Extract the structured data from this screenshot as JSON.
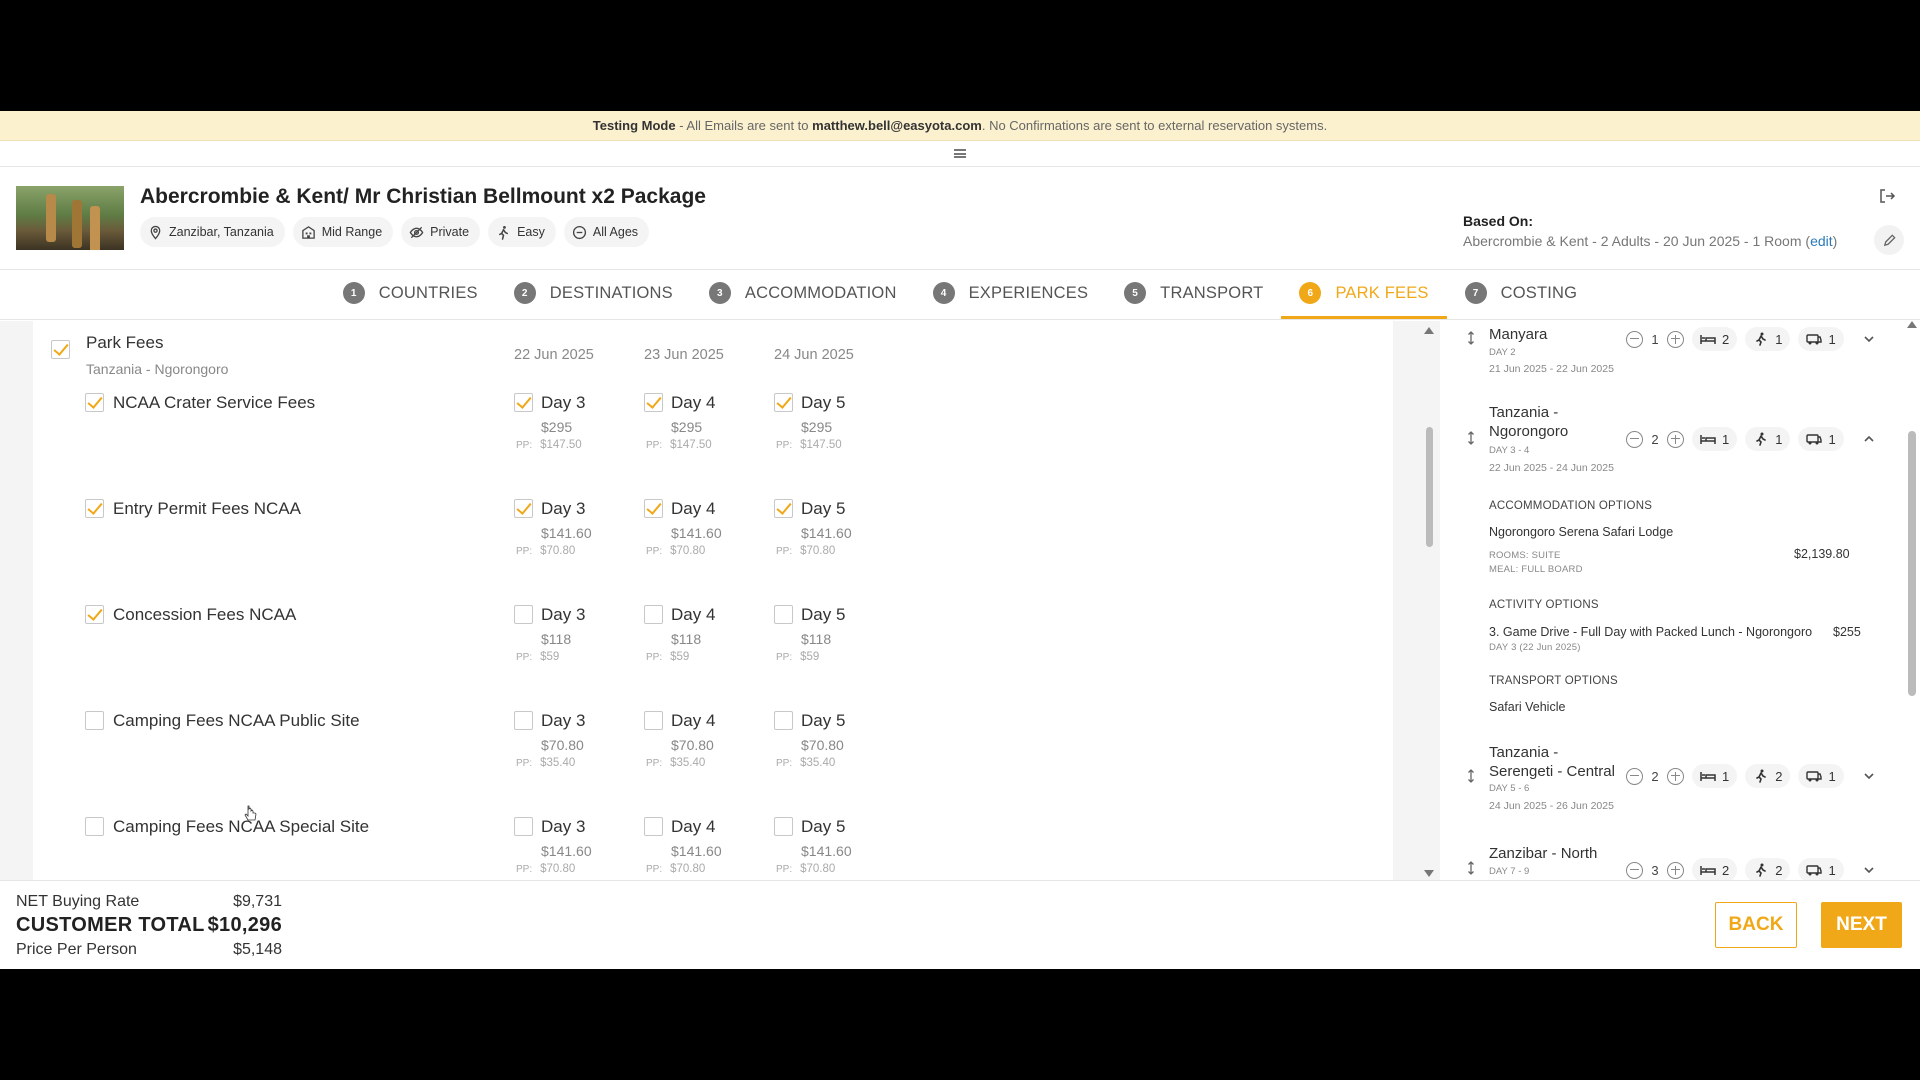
{
  "banner": {
    "mode": "Testing Mode",
    "part1": " - All Emails are sent to ",
    "email": "matthew.bell@easyota.com",
    "part2": ". No Confirmations are sent to external reservation systems."
  },
  "package": {
    "title": "Abercrombie & Kent/ Mr Christian Bellmount x2 Package",
    "chips": {
      "location": "Zanzibar, Tanzania",
      "range": "Mid Range",
      "privacy": "Private",
      "level": "Easy",
      "ages": "All Ages"
    },
    "based_label": "Based On:",
    "based_value": "Abercrombie & Kent - 2 Adults - 20 Jun 2025 - 1 Room (",
    "edit": "edit",
    "based_close": ")"
  },
  "steps": [
    {
      "num": "1",
      "label": "COUNTRIES"
    },
    {
      "num": "2",
      "label": "DESTINATIONS"
    },
    {
      "num": "3",
      "label": "ACCOMMODATION"
    },
    {
      "num": "4",
      "label": "EXPERIENCES"
    },
    {
      "num": "5",
      "label": "TRANSPORT"
    },
    {
      "num": "6",
      "label": "PARK FEES"
    },
    {
      "num": "7",
      "label": "COSTING"
    }
  ],
  "park_fees": {
    "title": "Park Fees",
    "subtitle": "Tanzania - Ngorongoro",
    "dates": [
      "22 Jun 2025",
      "23 Jun 2025",
      "24 Jun 2025"
    ],
    "pp_label": "PP:",
    "fees": [
      {
        "name": "NCAA Crater Service Fees",
        "days": [
          {
            "label": "Day 3",
            "price": "$295",
            "pp": "$147.50"
          },
          {
            "label": "Day 4",
            "price": "$295",
            "pp": "$147.50"
          },
          {
            "label": "Day 5",
            "price": "$295",
            "pp": "$147.50"
          }
        ]
      },
      {
        "name": "Entry Permit Fees NCAA",
        "days": [
          {
            "label": "Day 3",
            "price": "$141.60",
            "pp": "$70.80"
          },
          {
            "label": "Day 4",
            "price": "$141.60",
            "pp": "$70.80"
          },
          {
            "label": "Day 5",
            "price": "$141.60",
            "pp": "$70.80"
          }
        ]
      },
      {
        "name": "Concession Fees NCAA",
        "days": [
          {
            "label": "Day 3",
            "price": "$118",
            "pp": "$59"
          },
          {
            "label": "Day 4",
            "price": "$118",
            "pp": "$59"
          },
          {
            "label": "Day 5",
            "price": "$118",
            "pp": "$59"
          }
        ]
      },
      {
        "name": "Camping Fees NCAA Public Site",
        "days": [
          {
            "label": "Day 3",
            "price": "$70.80",
            "pp": "$35.40"
          },
          {
            "label": "Day 4",
            "price": "$70.80",
            "pp": "$35.40"
          },
          {
            "label": "Day 5",
            "price": "$70.80",
            "pp": "$35.40"
          }
        ]
      },
      {
        "name": "Camping Fees NCAA Special Site",
        "days": [
          {
            "label": "Day 3",
            "price": "$141.60",
            "pp": "$70.80"
          },
          {
            "label": "Day 4",
            "price": "$141.60",
            "pp": "$70.80"
          },
          {
            "label": "Day 5",
            "price": "$141.60",
            "pp": "$70.80"
          }
        ]
      }
    ]
  },
  "itinerary": [
    {
      "name1": "Manyara",
      "name2": "",
      "day": "DAY 2",
      "dates": "21 Jun 2025 - 22 Jun 2025",
      "nights": "1",
      "beds": "2",
      "people": "1",
      "vehicles": "1"
    },
    {
      "name1": "Tanzania -",
      "name2": "Ngorongoro",
      "day": "DAY 3 - 4",
      "dates": "22 Jun 2025 - 24 Jun 2025",
      "nights": "2",
      "beds": "1",
      "people": "1",
      "vehicles": "1",
      "accommodation_header": "ACCOMMODATION OPTIONS",
      "lodge": "Ngorongoro Serena Safari Lodge",
      "rooms": "ROOMS: SUITE",
      "meal": "MEAL: FULL BOARD",
      "lodge_price": "$2,139.80",
      "activity_header": "ACTIVITY OPTIONS",
      "activity": "3. Game Drive - Full Day with Packed Lunch - Ngorongoro",
      "activity_price": "$255",
      "activity_day": "DAY 3  (22 Jun 2025)",
      "transport_header": "TRANSPORT OPTIONS",
      "transport": "Safari Vehicle"
    },
    {
      "name1": "Tanzania -",
      "name2": "Serengeti - Central",
      "day": "DAY 5 - 6",
      "dates": "24 Jun 2025 - 26 Jun 2025",
      "nights": "2",
      "beds": "1",
      "people": "2",
      "vehicles": "1"
    },
    {
      "name1": "Zanzibar - North",
      "name2": "",
      "day": "DAY 7 - 9",
      "dates": "",
      "nights": "3",
      "beds": "2",
      "people": "2",
      "vehicles": "1"
    }
  ],
  "totals": {
    "net_label": "NET Buying Rate",
    "net_value": "$9,731",
    "customer_label": "CUSTOMER TOTAL",
    "customer_value": "$10,296",
    "pp_label": "Price Per Person",
    "pp_value": "$5,148"
  },
  "buttons": {
    "back": "BACK",
    "next": "NEXT"
  },
  "colors": {
    "accent": "#f0a818",
    "banner_bg": "#fcf1cf",
    "link": "#2a7ab8"
  }
}
